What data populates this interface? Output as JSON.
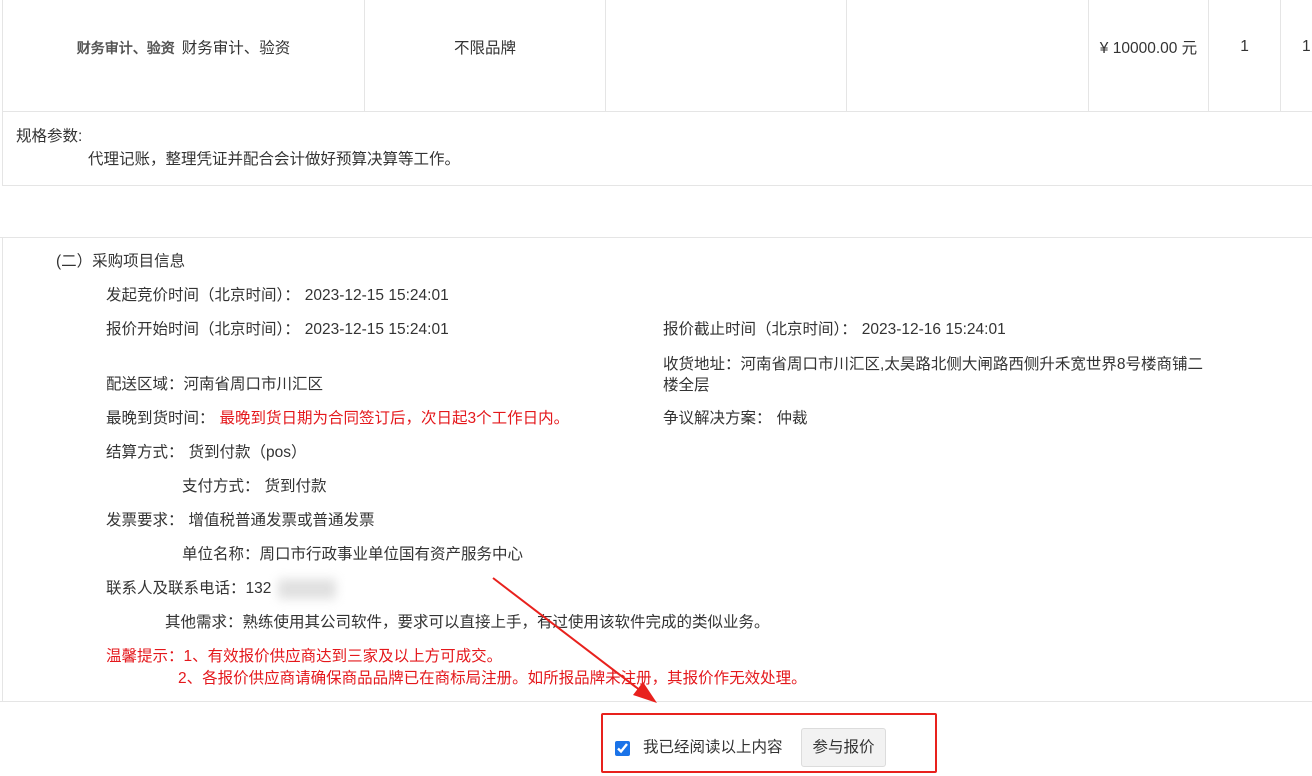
{
  "colors": {
    "text": "#333333",
    "border": "#e5e5e5",
    "warning": "#e4181c",
    "checkbox_accent": "#1a73e8",
    "annotation": "#e8211d",
    "button_bg": "#f2f2f2",
    "tag": "#555555"
  },
  "product_row": {
    "category_tag": "财务审计、验资",
    "name": "财务审计、验资",
    "brand": "不限品牌",
    "price": "¥ 10000.00 元",
    "quantity": "1",
    "next_column_value": "1"
  },
  "spec_params": {
    "label": "规格参数:",
    "text": "代理记账，整理凭证并配合会计做好预算决算等工作。"
  },
  "project_info": {
    "title": "(二）采购项目信息",
    "bid_start": {
      "label": "发起竞价时间（北京时间）：",
      "value": "2023-12-15 15:24:01"
    },
    "quote_start": {
      "label": "报价开始时间（北京时间）：",
      "value": "2023-12-15 15:24:01"
    },
    "quote_deadline": {
      "label": "报价截止时间（北京时间）：",
      "value": "2023-12-16 15:24:01"
    },
    "delivery_address": {
      "label": "收货地址：",
      "value": "河南省周口市川汇区,太昊路北侧大闸路西侧升禾宽世界8号楼商铺二楼全层"
    },
    "delivery_area": {
      "label": "配送区域：",
      "value": "河南省周口市川汇区"
    },
    "latest_delivery": {
      "label": "最晚到货时间：",
      "value": "最晚到货日期为合同签订后，次日起3个工作日内。"
    },
    "dispute_resolution": {
      "label": "争议解决方案：",
      "value": "仲裁"
    },
    "settlement": {
      "label": "结算方式：",
      "value": "货到付款（pos）"
    },
    "payment": {
      "label": "支付方式：",
      "value": "货到付款"
    },
    "invoice": {
      "label": "发票要求：",
      "value": "增值税普通发票或普通发票"
    },
    "unit_name": {
      "label": "单位名称：",
      "value": "周口市行政事业单位国有资产服务中心"
    },
    "contact": {
      "label": "联系人及联系电话：",
      "value_visible": "132"
    },
    "other_requirements": {
      "label": "其他需求：",
      "value": "熟练使用其公司软件，要求可以直接上手，有过使用该软件完成的类似业务。"
    },
    "tips": {
      "label": "温馨提示：",
      "items": [
        "1、有效报价供应商达到三家及以上方可成交。",
        "2、各报价供应商请确保商品品牌已在商标局注册。如所报品牌未注册，其报价作无效处理。"
      ]
    }
  },
  "footer": {
    "agree_checked": true,
    "agree_label": "我已经阅读以上内容",
    "submit_label": "参与报价"
  }
}
